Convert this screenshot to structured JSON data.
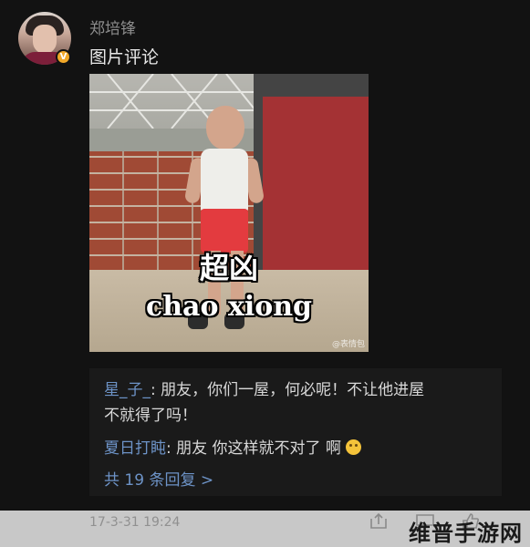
{
  "comment": {
    "username": "郑培锋",
    "text": "图片评论",
    "verified_badge": "V",
    "photo": {
      "caption_cn": "超凶",
      "caption_en": "chao xiong",
      "watermark": "@表情包"
    }
  },
  "replies": [
    {
      "author": "星_子_",
      "separator": ":",
      "text_line1": " 朋友，你们一屋，何必呢！不让他进屋",
      "text_line2": "不就得了吗！"
    },
    {
      "author": "夏日打盹",
      "separator": ":",
      "text": " 朋友 你这样就不对了 啊 ",
      "emoji": "thinking-emoji"
    }
  ],
  "more_replies_label": "共 19 条回复 >",
  "footer": {
    "timestamp": "17-3-31 19:24",
    "icons": [
      "share-icon",
      "comment-icon",
      "like-icon"
    ]
  },
  "site_watermark": "维普手游网",
  "colors": {
    "background": "#121212",
    "reply_box": "#1a1a1a",
    "link_blue": "#6d93c7",
    "badge_orange": "#f1a829"
  }
}
